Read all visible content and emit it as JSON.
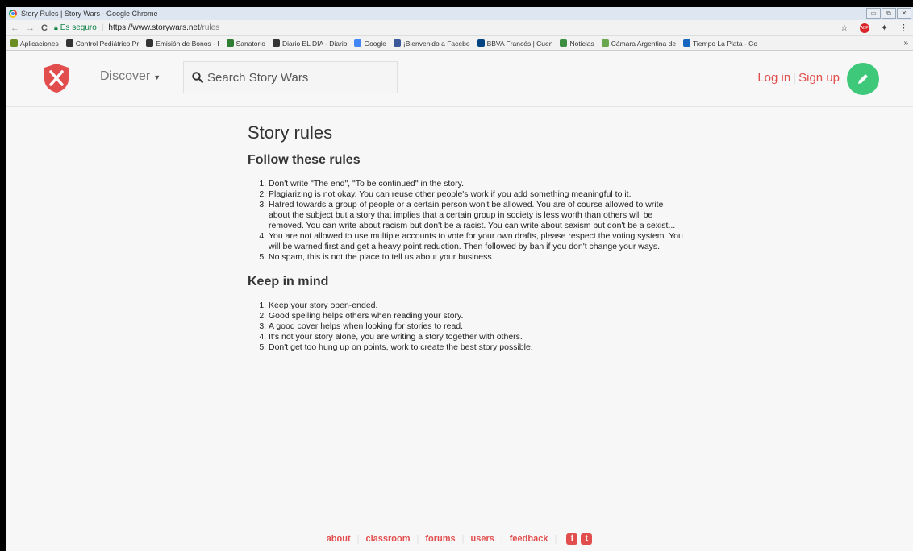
{
  "window": {
    "title": "Story Rules | Story Wars - Google Chrome"
  },
  "browser": {
    "secure_label": "Es seguro",
    "url_host": "https://www.storywars.net",
    "url_path": "/rules"
  },
  "bookmarks": [
    {
      "label": "Aplicaciones",
      "color": "#6b8e23"
    },
    {
      "label": "Control Pediátrico Pr",
      "color": "#333333"
    },
    {
      "label": "Emisión de Bonos - I",
      "color": "#333333"
    },
    {
      "label": "Sanatorio",
      "color": "#2e7d32"
    },
    {
      "label": "Diario EL DIA - Diario",
      "color": "#333333"
    },
    {
      "label": "Google",
      "color": "#4285f4"
    },
    {
      "label": "¡Bienvenido a Facebo",
      "color": "#3b5998"
    },
    {
      "label": "BBVA Francés | Cuen",
      "color": "#004481"
    },
    {
      "label": "Noticias",
      "color": "#3e8e41"
    },
    {
      "label": "Cámara Argentina de",
      "color": "#6aa84f"
    },
    {
      "label": "Tiempo La Plata - Co",
      "color": "#1565c0"
    }
  ],
  "header": {
    "discover_label": "Discover",
    "search_placeholder": "Search Story Wars",
    "login_label": "Log in",
    "signup_label": "Sign up"
  },
  "main": {
    "title": "Story rules",
    "rules_heading": "Follow these rules",
    "rules": [
      "Don't write \"The end\", \"To be continued\" in the story.",
      "Plagiarizing is not okay. You can reuse other people's work if you add something meaningful to it.",
      "Hatred towards a group of people or a certain person won't be allowed. You are of course allowed to write about the subject but a story that implies that a certain group in society is less worth than others will be removed. You can write about racism but don't be a racist. You can write about sexism but don't be a sexist...",
      "You are not allowed to use multiple accounts to vote for your own drafts, please respect the voting system. You will be warned first and get a heavy point reduction. Then followed by ban if you don't change your ways.",
      "No spam, this is not the place to tell us about your business."
    ],
    "mind_heading": "Keep in mind",
    "mind": [
      "Keep your story open-ended.",
      "Good spelling helps others when reading your story.",
      "A good cover helps when looking for stories to read.",
      "It's not your story alone, you are writing a story together with others.",
      "Don't get too hung up on points, work to create the best story possible."
    ]
  },
  "footer": {
    "links": [
      "about",
      "classroom",
      "forums",
      "users",
      "feedback"
    ]
  },
  "colors": {
    "accent": "#e24d4d",
    "write_button": "#3ec87a"
  }
}
